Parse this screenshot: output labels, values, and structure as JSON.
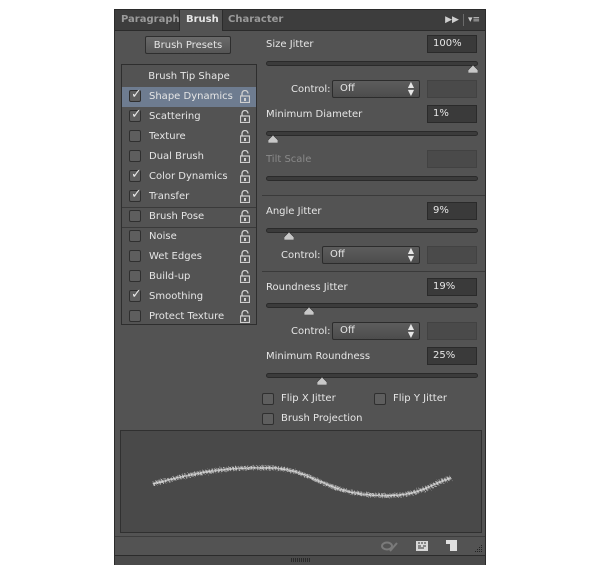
{
  "tabs": [
    {
      "label": "Paragraph",
      "active": false
    },
    {
      "label": "Brush",
      "active": true
    },
    {
      "label": "Character",
      "active": false
    }
  ],
  "panel_icons": [
    "collapse-arrows-icon",
    "panel-menu-icon"
  ],
  "presets_button": "Brush Presets",
  "left_list": {
    "header": "Brush Tip Shape",
    "items": [
      {
        "label": "Shape Dynamics",
        "checked": true,
        "selected": true
      },
      {
        "label": "Scattering",
        "checked": true,
        "selected": false
      },
      {
        "label": "Texture",
        "checked": false,
        "selected": false
      },
      {
        "label": "Dual Brush",
        "checked": false,
        "selected": false
      },
      {
        "label": "Color Dynamics",
        "checked": true,
        "selected": false
      },
      {
        "label": "Transfer",
        "checked": true,
        "selected": false
      },
      {
        "label": "Brush Pose",
        "checked": false,
        "selected": false
      },
      {
        "label": "Noise",
        "checked": false,
        "selected": false
      },
      {
        "label": "Wet Edges",
        "checked": false,
        "selected": false
      },
      {
        "label": "Build-up",
        "checked": false,
        "selected": false
      },
      {
        "label": "Smoothing",
        "checked": true,
        "selected": false
      },
      {
        "label": "Protect Texture",
        "checked": false,
        "selected": false
      }
    ]
  },
  "settings": {
    "size_jitter": {
      "label": "Size Jitter",
      "value": "100%",
      "slider": 1.0
    },
    "size_control": {
      "label": "Control:",
      "value": "Off"
    },
    "minimum_diameter": {
      "label": "Minimum Diameter",
      "value": "1%",
      "slider": 0.01
    },
    "tilt_scale": {
      "label": "Tilt Scale",
      "value": "",
      "disabled": true
    },
    "angle_jitter": {
      "label": "Angle Jitter",
      "value": "9%",
      "slider": 0.09
    },
    "angle_control": {
      "label": "Control:",
      "value": "Off"
    },
    "roundness_jitter": {
      "label": "Roundness Jitter",
      "value": "19%",
      "slider": 0.19
    },
    "roundness_control": {
      "label": "Control:",
      "value": "Off"
    },
    "minimum_roundness": {
      "label": "Minimum Roundness",
      "value": "25%",
      "slider": 0.25
    },
    "flip_x": {
      "label": "Flip X Jitter",
      "checked": false
    },
    "flip_y": {
      "label": "Flip Y Jitter",
      "checked": false
    },
    "brush_projection": {
      "label": "Brush Projection",
      "checked": false
    }
  },
  "bottom_icons": [
    "toggle-live-tip-preview-icon",
    "open-preset-manager-icon",
    "create-new-brush-icon"
  ]
}
